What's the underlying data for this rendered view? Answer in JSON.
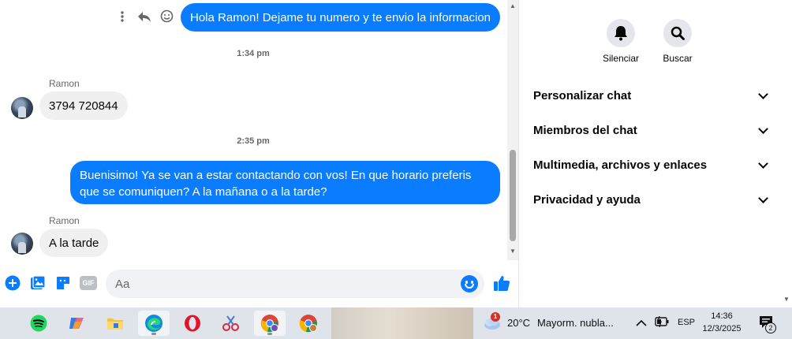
{
  "messages": {
    "outgoing_1": "Hola Ramon! Dejame tu numero y te envio la informacion",
    "timestamp_1": "1:34 pm",
    "sender_1": "Ramon",
    "incoming_1": "3794 720844",
    "timestamp_2": "2:35 pm",
    "outgoing_2": "Buenisimo! Ya se van a estar contactando con vos! En que horario preferis que se comuniquen? A la mañana o a la tarde?",
    "sender_2": "Ramon",
    "incoming_2": "A la tarde"
  },
  "composer": {
    "placeholder": "Aa",
    "gif_label": "GIF"
  },
  "side_panel": {
    "mute_label": "Silenciar",
    "search_label": "Buscar",
    "sections": [
      "Personalizar chat",
      "Miembros del chat",
      "Multimedia, archivos y enlaces",
      "Privacidad y ayuda"
    ]
  },
  "taskbar": {
    "weather_temp": "20°C",
    "weather_desc": "Mayorm. nubla...",
    "weather_alert": "1",
    "language": "ESP",
    "time": "14:36",
    "date": "12/3/2025",
    "notifications": "2"
  },
  "colors": {
    "messenger_blue": "#0a7cff",
    "bubble_in": "#f0f0f0"
  }
}
